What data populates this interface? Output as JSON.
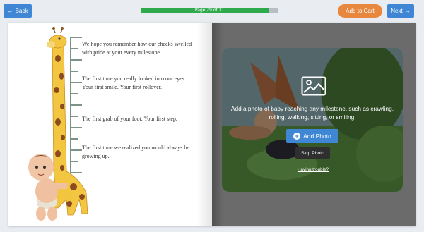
{
  "topbar": {
    "back_label": "Back",
    "progress_text": "Page 29 of 31",
    "progress_fraction": 0.94,
    "cart_label": "Add to Cart",
    "next_label": "Next"
  },
  "left_page": {
    "paragraphs": [
      "We hope you remember how our cheeks swelled with pride at your every milestone.",
      "The first time you really looked into our eyes. Your first smile. Your first rollover.",
      "The first grab of your foot. Your first step.",
      "The first time we realized you would always be growing up."
    ]
  },
  "right_page": {
    "prompt": "Add a photo of baby reaching any milestone, such as crawling, rolling, walking, sitting, or smiling.",
    "add_photo_label": "Add Photo",
    "skip_label": "Skip Photo",
    "trouble_label": "Having trouble?"
  },
  "colors": {
    "primary": "#3f87d4",
    "accent": "#e8883f",
    "progress": "#2eaa4d"
  },
  "icons": [
    "arrow-left-icon",
    "arrow-right-icon",
    "image-icon",
    "plus-circle-icon",
    "giraffe-illustration",
    "baby-illustration"
  ]
}
